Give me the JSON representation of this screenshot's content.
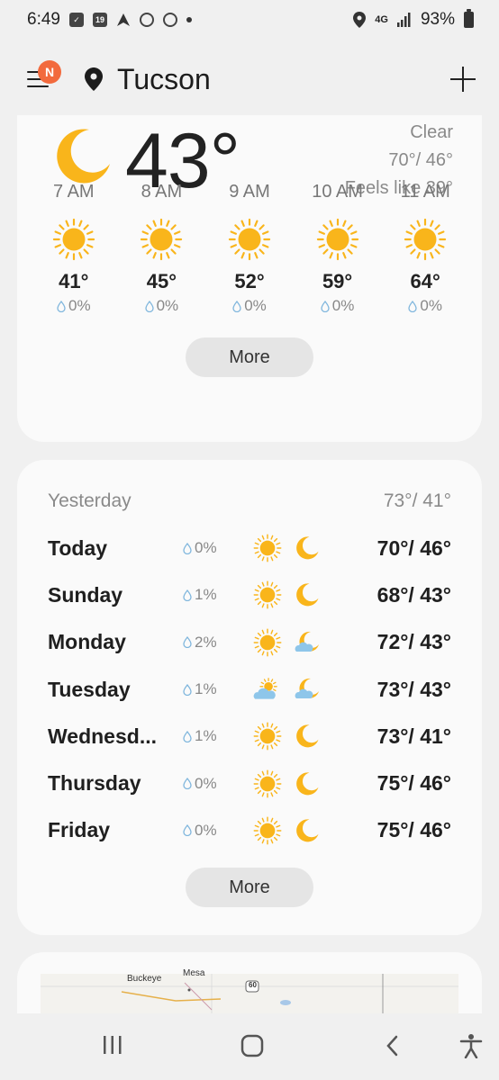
{
  "status_bar": {
    "time": "6:49",
    "network": "4G",
    "battery": "93%"
  },
  "header": {
    "notification_badge": "N",
    "city": "Tucson"
  },
  "current": {
    "temperature": "43°",
    "condition": "Clear",
    "high_low": "70°/ 46°",
    "feels_like": "Feels like 39°",
    "condition_icon": "moon-icon"
  },
  "hourly": [
    {
      "time": "7 AM",
      "icon": "sun-icon",
      "temp": "41°",
      "precip": "0%"
    },
    {
      "time": "8 AM",
      "icon": "sun-icon",
      "temp": "45°",
      "precip": "0%"
    },
    {
      "time": "9 AM",
      "icon": "sun-icon",
      "temp": "52°",
      "precip": "0%"
    },
    {
      "time": "10 AM",
      "icon": "sun-icon",
      "temp": "59°",
      "precip": "0%"
    },
    {
      "time": "11 AM",
      "icon": "sun-icon",
      "temp": "64°",
      "precip": "0%"
    }
  ],
  "hourly_more_label": "More",
  "daily": {
    "yesterday_label": "Yesterday",
    "yesterday_temps": "73°/ 41°",
    "days": [
      {
        "name": "Today",
        "precip": "0%",
        "day_icon": "sun-icon",
        "night_icon": "moon-icon",
        "temps": "70°/ 46°"
      },
      {
        "name": "Sunday",
        "precip": "1%",
        "day_icon": "sun-icon",
        "night_icon": "moon-icon",
        "temps": "68°/ 43°"
      },
      {
        "name": "Monday",
        "precip": "2%",
        "day_icon": "sun-icon",
        "night_icon": "moon-cloud-icon",
        "temps": "72°/ 43°"
      },
      {
        "name": "Tuesday",
        "precip": "1%",
        "day_icon": "sun-cloud-icon",
        "night_icon": "moon-cloud-icon",
        "temps": "73°/ 43°"
      },
      {
        "name": "Wednesd...",
        "precip": "1%",
        "day_icon": "sun-icon",
        "night_icon": "moon-icon",
        "temps": "73°/ 41°"
      },
      {
        "name": "Thursday",
        "precip": "0%",
        "day_icon": "sun-icon",
        "night_icon": "moon-icon",
        "temps": "75°/ 46°"
      },
      {
        "name": "Friday",
        "precip": "0%",
        "day_icon": "sun-icon",
        "night_icon": "moon-icon",
        "temps": "75°/ 46°"
      }
    ],
    "more_label": "More"
  },
  "map": {
    "labels": [
      "Buckeye",
      "Mesa",
      "60"
    ]
  },
  "colors": {
    "sun": "#f9b51b",
    "moon": "#f9b51b",
    "cloud": "#8ec6ea",
    "badge": "#f26a3d",
    "card": "#fafafa",
    "background": "#f0f0f0"
  }
}
